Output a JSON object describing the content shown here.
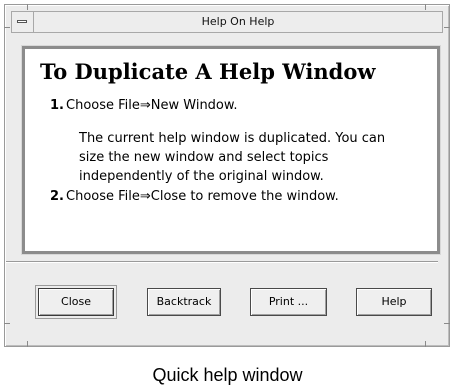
{
  "window": {
    "title": "Help On Help"
  },
  "help": {
    "topic_title": "To Duplicate A Help Window",
    "steps": [
      {
        "number": "1.",
        "text": "Choose File⇒New Window.",
        "note_lines": [
          "The current help window is duplicated. You can",
          "size the new window and select topics",
          "independently of the original window."
        ]
      },
      {
        "number": "2.",
        "text": "Choose File⇒Close to remove the window."
      }
    ]
  },
  "buttons": {
    "close": "Close",
    "backtrack": "Backtrack",
    "print": "Print ...",
    "help": "Help"
  },
  "caption": "Quick help window",
  "colors": {
    "window_background": "#ececec",
    "content_background": "#ffffff",
    "border": "#8c8c8c"
  },
  "icons": {
    "window_menu": "window-menu-icon"
  }
}
